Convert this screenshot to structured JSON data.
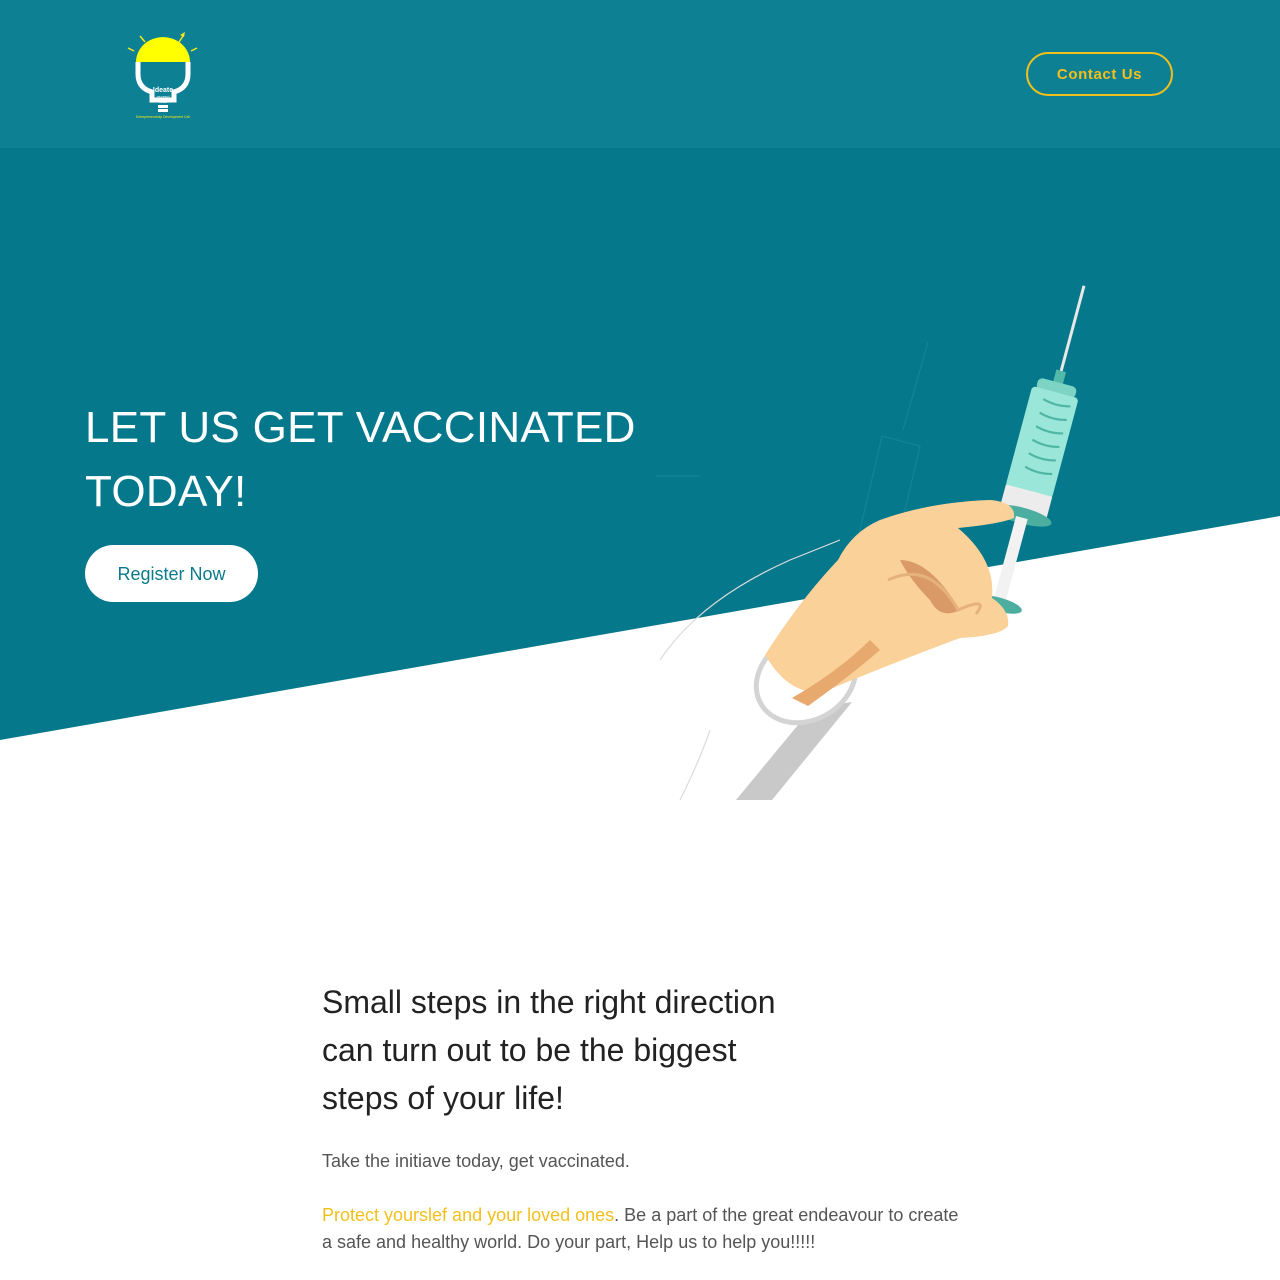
{
  "header": {
    "logo_icon": "lightbulb-logo-icon",
    "logo_text": [
      "Ideate",
      "ascend",
      "lead",
      "Entrepreneurship Development Cell"
    ],
    "contact_label": "Contact Us"
  },
  "hero": {
    "title": "LET US GET VACCINATED TODAY!",
    "register_label": "Register Now",
    "illustration": "hand-holding-syringe-illustration"
  },
  "content": {
    "heading": "Small steps in the right direction can turn out to be the biggest steps of your life!",
    "paragraph1": "Take the initiave today, get vaccinated.",
    "paragraph2_highlight": "Protect yourslef and your loved ones",
    "paragraph2_rest": ". Be a part of the great endeavour to create a safe and healthy world. Do your part, Help us to help you!!!!!"
  },
  "colors": {
    "header_bg": "#0e8094",
    "hero_bg": "#05788b",
    "accent": "#f2c01b",
    "text_dark": "#222222",
    "text_body": "#555555"
  }
}
